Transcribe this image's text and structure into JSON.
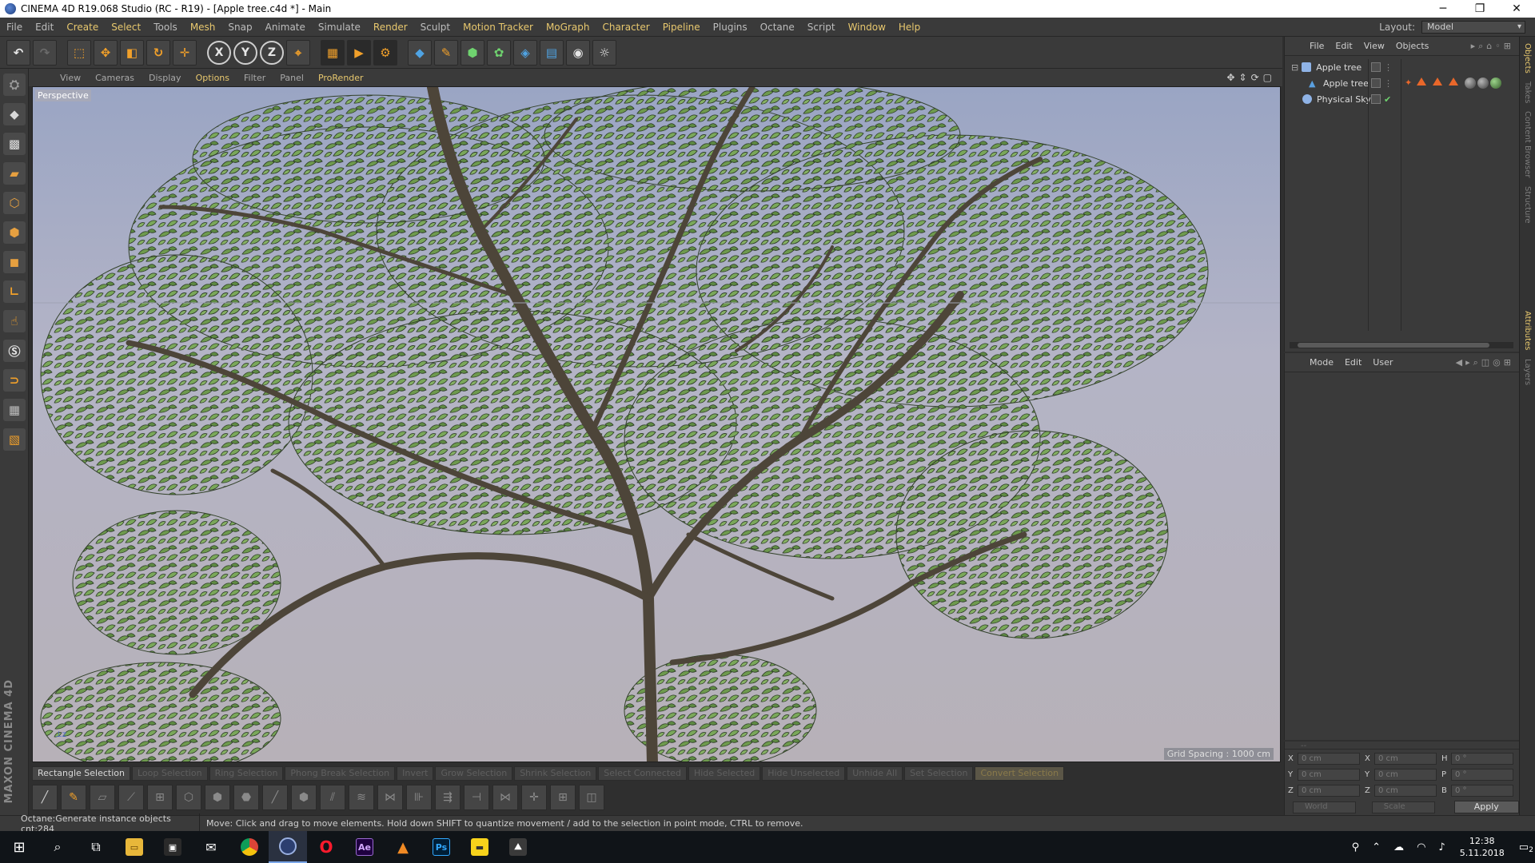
{
  "window": {
    "title": "CINEMA 4D R19.068 Studio (RC - R19) - [Apple tree.c4d *] - Main",
    "controls": [
      "─",
      "❐",
      "✕"
    ]
  },
  "menu": {
    "items": [
      "File",
      "Edit",
      "Create",
      "Select",
      "Tools",
      "Mesh",
      "Snap",
      "Animate",
      "Simulate",
      "Render",
      "Sculpt",
      "Motion Tracker",
      "MoGraph",
      "Character",
      "Pipeline",
      "Plugins",
      "Octane",
      "Script",
      "Window",
      "Help"
    ],
    "layout_label": "Layout:",
    "layout_value": "Model"
  },
  "viewport": {
    "menu": [
      "View",
      "Cameras",
      "Display",
      "Options",
      "Filter",
      "Panel",
      "ProRender"
    ],
    "camera_label": "Perspective",
    "grid_spacing": "Grid Spacing : 1000 cm"
  },
  "selection_tools": [
    "Rectangle Selection",
    "Loop Selection",
    "Ring Selection",
    "Phong Break Selection",
    "Invert",
    "Grow Selection",
    "Shrink Selection",
    "Select Connected",
    "Hide Selected",
    "Hide Unselected",
    "Unhide All",
    "Set Selection",
    "Convert Selection"
  ],
  "statusbar": {
    "left": "Octane:Generate instance objects cnt:284",
    "message": "Move: Click and drag to move elements. Hold down SHIFT to quantize movement / add to the selection in point mode, CTRL to remove."
  },
  "object_manager": {
    "menu": [
      "File",
      "Edit",
      "View",
      "Objects"
    ],
    "objects": [
      {
        "name": "Apple tree",
        "indent": 0,
        "icon_color": "#8fb3e6"
      },
      {
        "name": "Apple tree",
        "indent": 1,
        "icon_color": "#5aa0e0"
      },
      {
        "name": "Physical Sky",
        "indent": 0,
        "icon_color": "#8fb3e6"
      }
    ]
  },
  "attribute_manager": {
    "menu": [
      "Mode",
      "Edit",
      "User"
    ]
  },
  "coordinates": {
    "rows": [
      [
        {
          "l": "X",
          "v": "0 cm"
        },
        {
          "l": "X",
          "v": "0 cm"
        },
        {
          "l": "H",
          "v": "0 °"
        }
      ],
      [
        {
          "l": "Y",
          "v": "0 cm"
        },
        {
          "l": "Y",
          "v": "0 cm"
        },
        {
          "l": "P",
          "v": "0 °"
        }
      ],
      [
        {
          "l": "Z",
          "v": "0 cm"
        },
        {
          "l": "Z",
          "v": "0 cm"
        },
        {
          "l": "B",
          "v": "0 °"
        }
      ]
    ],
    "world": "World",
    "scale": "Scale",
    "apply": "Apply"
  },
  "right_tabs": [
    "Objects",
    "Takes",
    "Content Browser",
    "Structure",
    "Attributes",
    "Layers"
  ],
  "branding": "MAXON CINEMA 4D",
  "taskbar": {
    "apps": [
      "Start",
      "Search",
      "Task View",
      "File Explorer",
      "Store",
      "Mail",
      "Chrome",
      "Cinema 4D",
      "Opera",
      "Ae",
      "VLC",
      "Ps",
      "Sticky",
      "Photos"
    ],
    "time": "12:38",
    "date": "5.11.2018",
    "notifications": "2"
  },
  "colors": {
    "accent": "#e8c86e",
    "panel": "#3a3a3a",
    "leaf": "#6e9a4e"
  }
}
